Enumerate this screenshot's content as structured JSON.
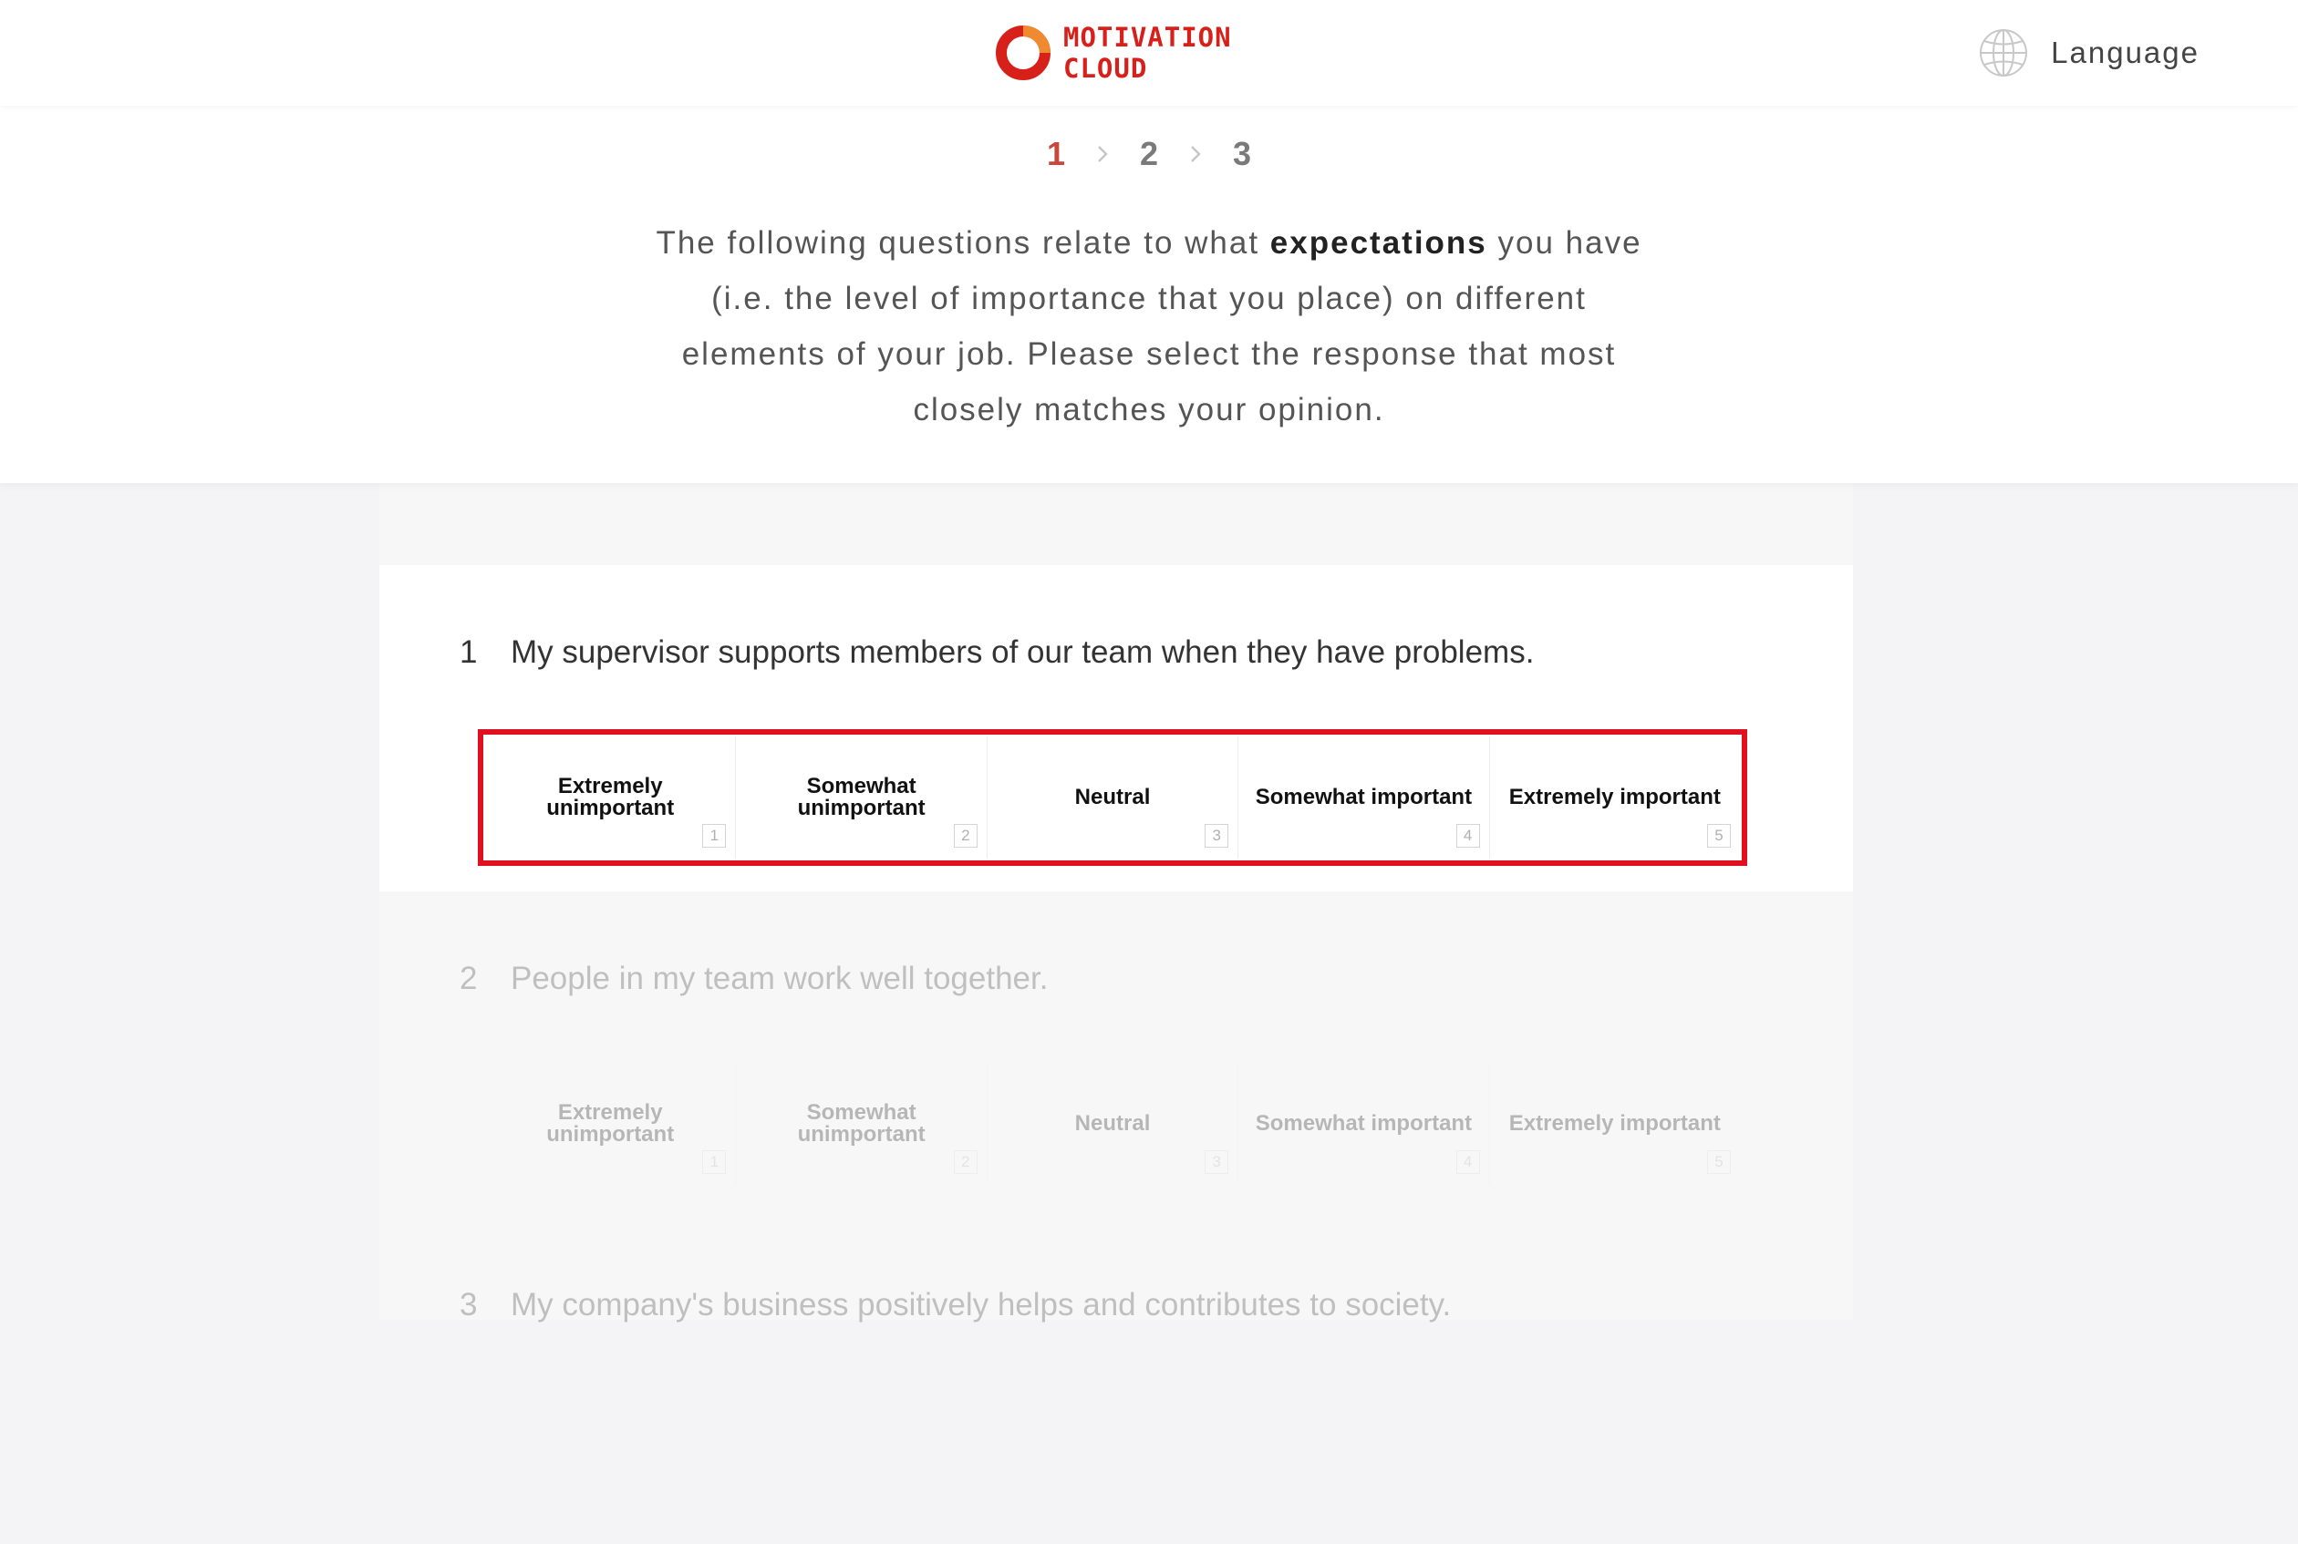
{
  "header": {
    "logo_line1": "MOTIVATION",
    "logo_line2": "CLOUD",
    "logo_icon": "red-ring-icon",
    "language_icon": "globe-icon",
    "language_label": "Language",
    "brand_color": "#d7201a"
  },
  "steps": {
    "items": [
      "1",
      "2",
      "3"
    ],
    "active_index": 0,
    "separator_icon": "chevron-right-icon"
  },
  "intro": {
    "text_before": "The following questions relate to what ",
    "text_bold": "expectations",
    "text_after": " you have (i.e. the level of importance that you place) on different elements of your job. Please select the response that most closely matches your opinion."
  },
  "questions": [
    {
      "number": "1",
      "text": "My supervisor supports members of our team when they have problems.",
      "options": [
        {
          "label": "Extremely unimportant",
          "num": "1"
        },
        {
          "label": "Somewhat unimportant",
          "num": "2"
        },
        {
          "label": "Neutral",
          "num": "3"
        },
        {
          "label": "Somewhat important",
          "num": "4"
        },
        {
          "label": "Extremely important",
          "num": "5"
        }
      ]
    },
    {
      "number": "2",
      "text": "People in my team work well together.",
      "options": [
        {
          "label": "Extremely unimportant",
          "num": "1"
        },
        {
          "label": "Somewhat unimportant",
          "num": "2"
        },
        {
          "label": "Neutral",
          "num": "3"
        },
        {
          "label": "Somewhat important",
          "num": "4"
        },
        {
          "label": "Extremely important",
          "num": "5"
        }
      ]
    },
    {
      "number": "3",
      "text": "My company's business positively helps and contributes to society."
    }
  ],
  "highlight_color": "#e0101e"
}
